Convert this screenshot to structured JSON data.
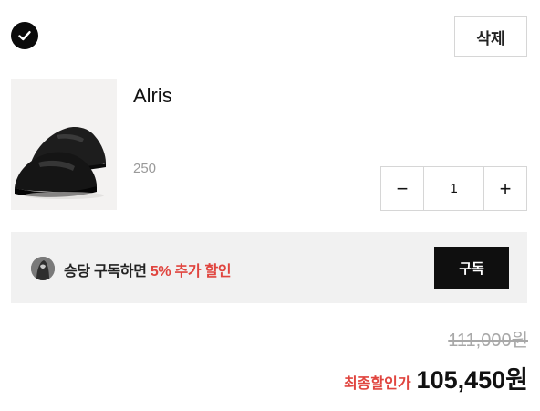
{
  "item": {
    "selected": true,
    "delete_label": "삭제",
    "product_name": "Alris",
    "option": "250",
    "quantity": "1",
    "minus_symbol": "−",
    "plus_symbol": "+"
  },
  "promo": {
    "text_prefix": "승당 구독하면 ",
    "text_highlight": "5% 추가 할인",
    "subscribe_label": "구독"
  },
  "pricing": {
    "original_price": "111,000원",
    "final_label": "최종할인가",
    "final_price": "105,450원"
  },
  "colors": {
    "accent_red": "#e0453f",
    "dark": "#0f0f0f",
    "promo_bg": "#f1f1f1"
  },
  "icons": {
    "check": "check-icon",
    "minus": "minus-icon",
    "plus": "plus-icon"
  }
}
